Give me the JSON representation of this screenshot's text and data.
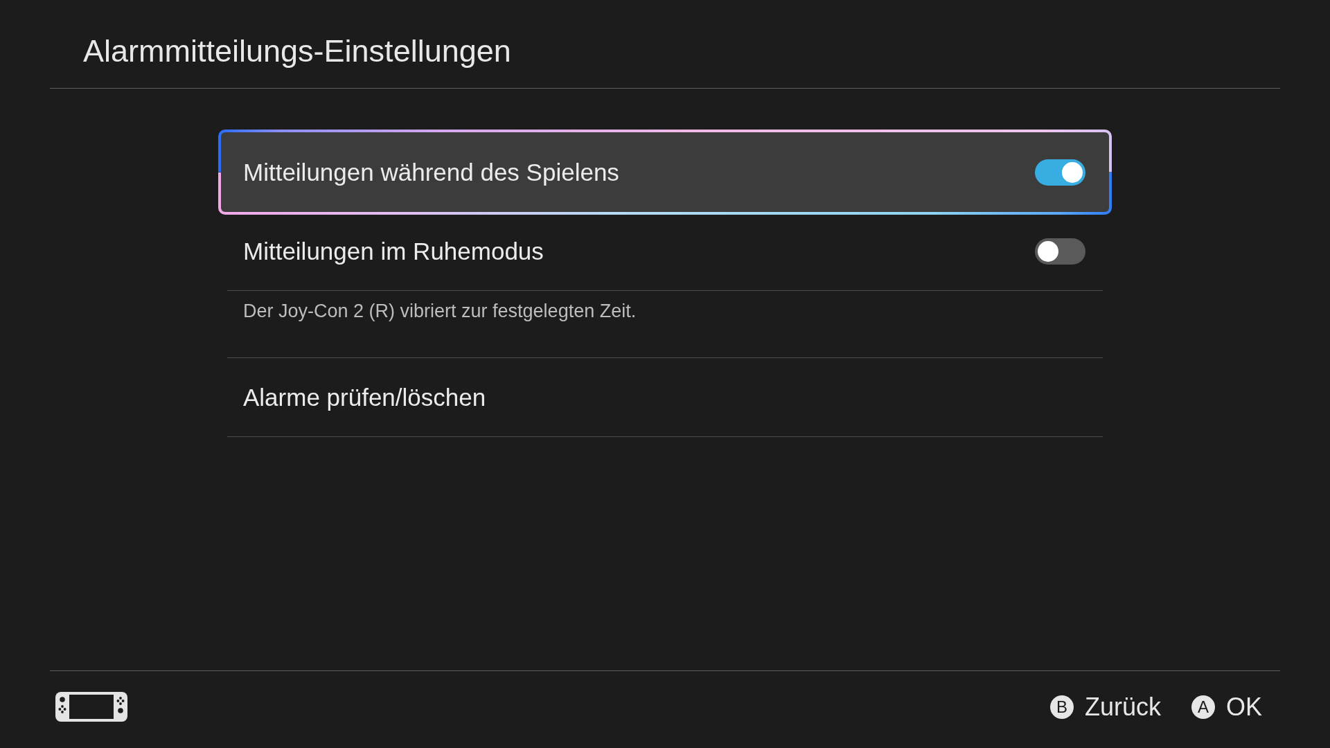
{
  "title": "Alarmmitteilungs-Einstellungen",
  "settings": [
    {
      "kind": "toggle",
      "label": "Mitteilungen während des Spielens",
      "on": true,
      "selected": true
    },
    {
      "kind": "toggle",
      "label": "Mitteilungen im Ruhemodus",
      "on": false,
      "selected": false,
      "note": "Der Joy-Con 2 (R) vibriert zur festgelegten Zeit."
    },
    {
      "kind": "link",
      "label": "Alarme prüfen/löschen",
      "selected": false
    }
  ],
  "footer": {
    "actions": [
      {
        "key": "B",
        "label": "Zurück"
      },
      {
        "key": "A",
        "label": "OK"
      }
    ]
  }
}
